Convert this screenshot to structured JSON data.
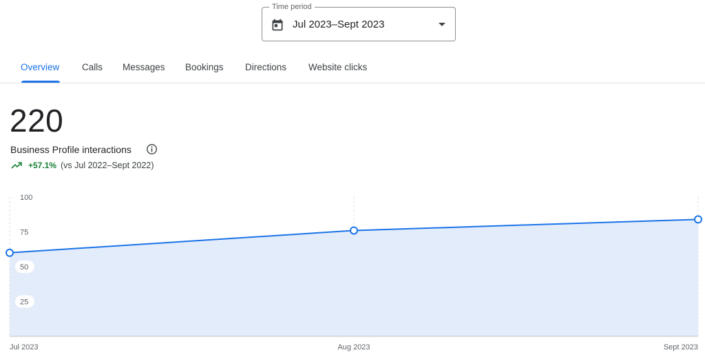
{
  "time_period": {
    "legend": "Time period",
    "value": "Jul 2023–Sept 2023",
    "icon": "calendar-icon"
  },
  "tabs": [
    {
      "label": "Overview",
      "active": true
    },
    {
      "label": "Calls",
      "active": false
    },
    {
      "label": "Messages",
      "active": false
    },
    {
      "label": "Bookings",
      "active": false
    },
    {
      "label": "Directions",
      "active": false
    },
    {
      "label": "Website clicks",
      "active": false
    }
  ],
  "metric": {
    "value": "220",
    "label": "Business Profile interactions",
    "trend_value": "+57.1%",
    "trend_compare": "(vs Jul 2022–Sept 2022)"
  },
  "colors": {
    "accent": "#1a73e8",
    "line": "#1a73e8",
    "area": "#e3ecfb",
    "trend_positive": "#188038"
  },
  "chart_data": {
    "type": "area",
    "categories": [
      "Jul 2023",
      "Aug 2023",
      "Sept 2023"
    ],
    "values": [
      60,
      76,
      84
    ],
    "yticks": [
      "100",
      "75",
      "50",
      "25"
    ],
    "ylim": [
      0,
      100
    ],
    "grid": "vertical dashed"
  }
}
